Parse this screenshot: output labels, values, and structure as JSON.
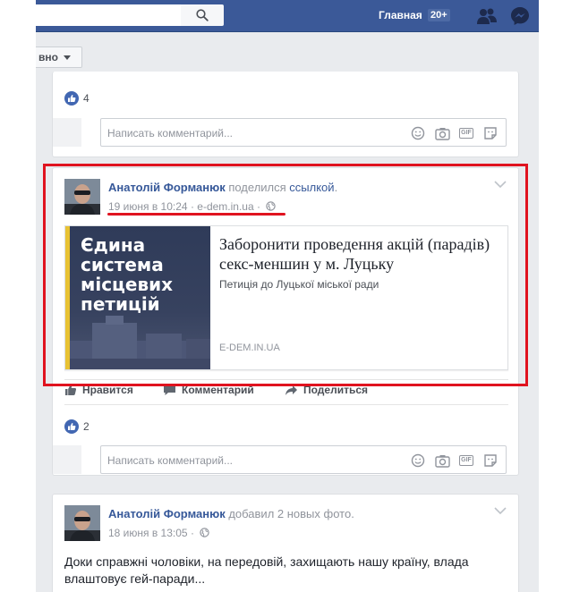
{
  "topbar": {
    "home_label": "Главная",
    "home_badge": "20+",
    "icons": [
      "search-icon",
      "friends-icon",
      "messenger-icon"
    ]
  },
  "feed": {
    "sort_label": "вно"
  },
  "previous_post": {
    "likes_count": "4",
    "comment_placeholder": "Написать комментарий..."
  },
  "shared_post": {
    "author": "Анатолій Форманюк",
    "action": "поделился",
    "object": "ссылкой",
    "period": ".",
    "timestamp": "19 июня в 10:24",
    "source": "e-dem.in.ua",
    "separator": "·",
    "preview": {
      "image_text_line1": "Єдина",
      "image_text_line2": "система",
      "image_text_line3": "місцевих",
      "image_text_line4": "петицій",
      "title": "Заборонити проведення акцій (парадів) секс-меншин у м. Луцьку",
      "description": "Петиція до Луцької міської ради",
      "domain": "E-DEM.IN.UA"
    },
    "actions": {
      "like": "Нравится",
      "comment": "Комментарий",
      "share": "Поделиться"
    },
    "likes_count": "2",
    "comment_placeholder": "Написать комментарий..."
  },
  "next_post": {
    "author": "Анатолій Форманюк",
    "action": "добавил 2 новых фото",
    "period": ".",
    "timestamp": "18 июня в 13:05",
    "separator": "·",
    "text": "Доки справжні чоловіки, на передовій, захищають нашу країну, влада влаштовує гей-паради..."
  },
  "colors": {
    "brand": "#3b5998",
    "link": "#365899",
    "highlight": "#e0131f"
  }
}
